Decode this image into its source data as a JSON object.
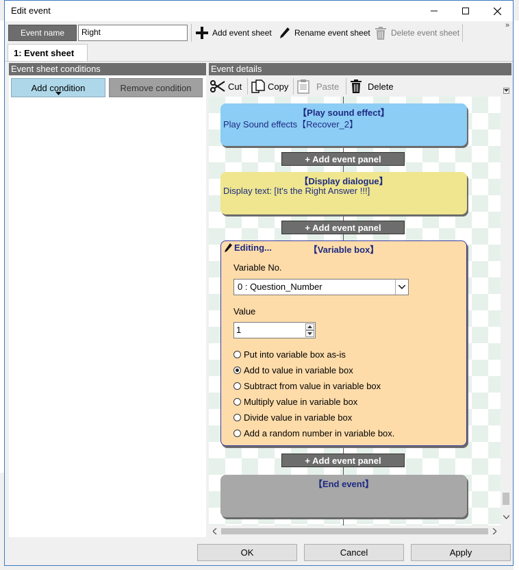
{
  "window": {
    "title": "Edit event"
  },
  "toolbar": {
    "event_name_label": "Event name",
    "event_name_value": "Right",
    "add_sheet": "Add event sheet",
    "rename_sheet": "Rename event sheet",
    "delete_sheet": "Delete event sheet"
  },
  "tabs": [
    {
      "label": "1: Event sheet"
    }
  ],
  "conditions": {
    "header": "Event sheet conditions",
    "add": "Add condition",
    "remove": "Remove condition"
  },
  "details": {
    "header": "Event details",
    "cut": "Cut",
    "copy": "Copy",
    "paste": "Paste",
    "delete": "Delete"
  },
  "events": {
    "sound": {
      "title": "【Play sound effect】",
      "text": "Play Sound effects【Recover_2】"
    },
    "dialogue": {
      "title": "【Display dialogue】",
      "text": "Display text: [It's the Right Answer !!!]"
    },
    "add_panel": "+ Add event panel",
    "variable": {
      "editing": "Editing...",
      "title": "【Variable box】",
      "variable_no_label": "Variable No.",
      "variable_no_value": "0 : Question_Number",
      "value_label": "Value",
      "value": "1",
      "options": [
        "Put into variable box as-is",
        "Add to value in variable box",
        "Subtract from value in variable box",
        "Multiply value in variable box",
        "Divide value in variable box",
        "Add a random number in variable box."
      ],
      "selected_index": 1
    },
    "end": {
      "title": "【End event】"
    }
  },
  "footer": {
    "ok": "OK",
    "cancel": "Cancel",
    "apply": "Apply"
  },
  "colors": {
    "sound_panel": "#8ccdf5",
    "dialogue_panel": "#efe68f",
    "variable_panel": "#fedcaa",
    "end_panel": "#a8a8a8",
    "panel_text": "#1e2a82"
  }
}
